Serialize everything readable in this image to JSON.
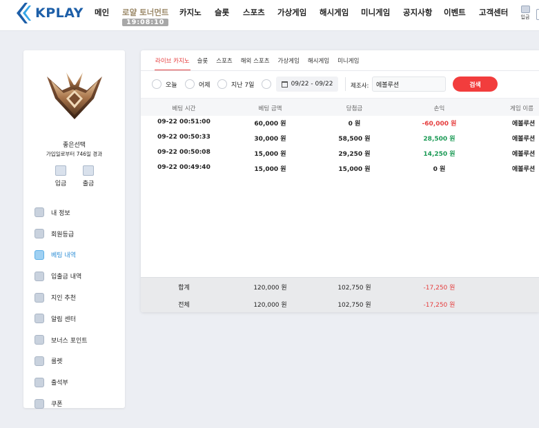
{
  "brand": {
    "name": "KPLAY",
    "color": "#1d5fa8"
  },
  "nav": {
    "items": [
      "메인",
      "카지노",
      "슬롯",
      "스포츠",
      "가상게임",
      "해시게임",
      "미니게임",
      "공지사항",
      "이벤트",
      "고객센터"
    ],
    "special": {
      "label": "로얄 토너먼트",
      "timer": "19:08:10"
    },
    "user_label": "입금"
  },
  "profile": {
    "name": "좋은선택",
    "subtitle": "가입일로부터 746일 경과",
    "deposit": "입금",
    "withdraw": "출금"
  },
  "menu": [
    {
      "label": "내 정보",
      "icon": "user-icon"
    },
    {
      "label": "회원등급",
      "icon": "heart-icon"
    },
    {
      "label": "베팅 내역",
      "icon": "betting-icon",
      "active": true
    },
    {
      "label": "입출금 내역",
      "icon": "wallet-icon"
    },
    {
      "label": "지인 추천",
      "icon": "recommend-icon"
    },
    {
      "label": "알림 센터",
      "icon": "chat-icon"
    },
    {
      "label": "보너스 포인트",
      "icon": "bonus-icon"
    },
    {
      "label": "룰렛",
      "icon": "roulette-icon"
    },
    {
      "label": "출석부",
      "icon": "attendance-icon"
    },
    {
      "label": "쿠폰",
      "icon": "coupon-icon"
    }
  ],
  "tabs": [
    "라이브 카지노",
    "슬롯",
    "스포츠",
    "해외 스포츠",
    "가상게임",
    "해시게임",
    "미니게임"
  ],
  "filters": {
    "today": "오늘",
    "yesterday": "어제",
    "last7": "지난 7일",
    "date_range": "09/22 - 09/22",
    "maker_label": "제조사:",
    "maker_value": "에볼루션",
    "search": "검색"
  },
  "table": {
    "columns": [
      "베팅 시간",
      "베팅 금액",
      "당첨금",
      "손익",
      "게임 이름"
    ],
    "rows": [
      {
        "time": "09-22 00:51:00",
        "bet": "60,000 원",
        "win": "0 원",
        "pl": "-60,000 원",
        "pl_type": "neg",
        "game": "에볼루션"
      },
      {
        "time": "09-22 00:50:33",
        "bet": "30,000 원",
        "win": "58,500 원",
        "pl": "28,500 원",
        "pl_type": "pos",
        "game": "에볼루션"
      },
      {
        "time": "09-22 00:50:08",
        "bet": "15,000 원",
        "win": "29,250 원",
        "pl": "14,250 원",
        "pl_type": "pos",
        "game": "에볼루션"
      },
      {
        "time": "09-22 00:49:40",
        "bet": "15,000 원",
        "win": "15,000 원",
        "pl": "0 원",
        "pl_type": "zero",
        "game": "에볼루션"
      }
    ],
    "footer": [
      {
        "label": "합계",
        "bet": "120,000 원",
        "win": "102,750 원",
        "pl": "-17,250 원"
      },
      {
        "label": "전체",
        "bet": "120,000 원",
        "win": "102,750 원",
        "pl": "-17,250 원"
      }
    ]
  },
  "colors": {
    "accent": "#e53b3b",
    "positive": "#1b9a55",
    "active_menu": "#2f8fd6",
    "search_button": "#f23d3d"
  }
}
